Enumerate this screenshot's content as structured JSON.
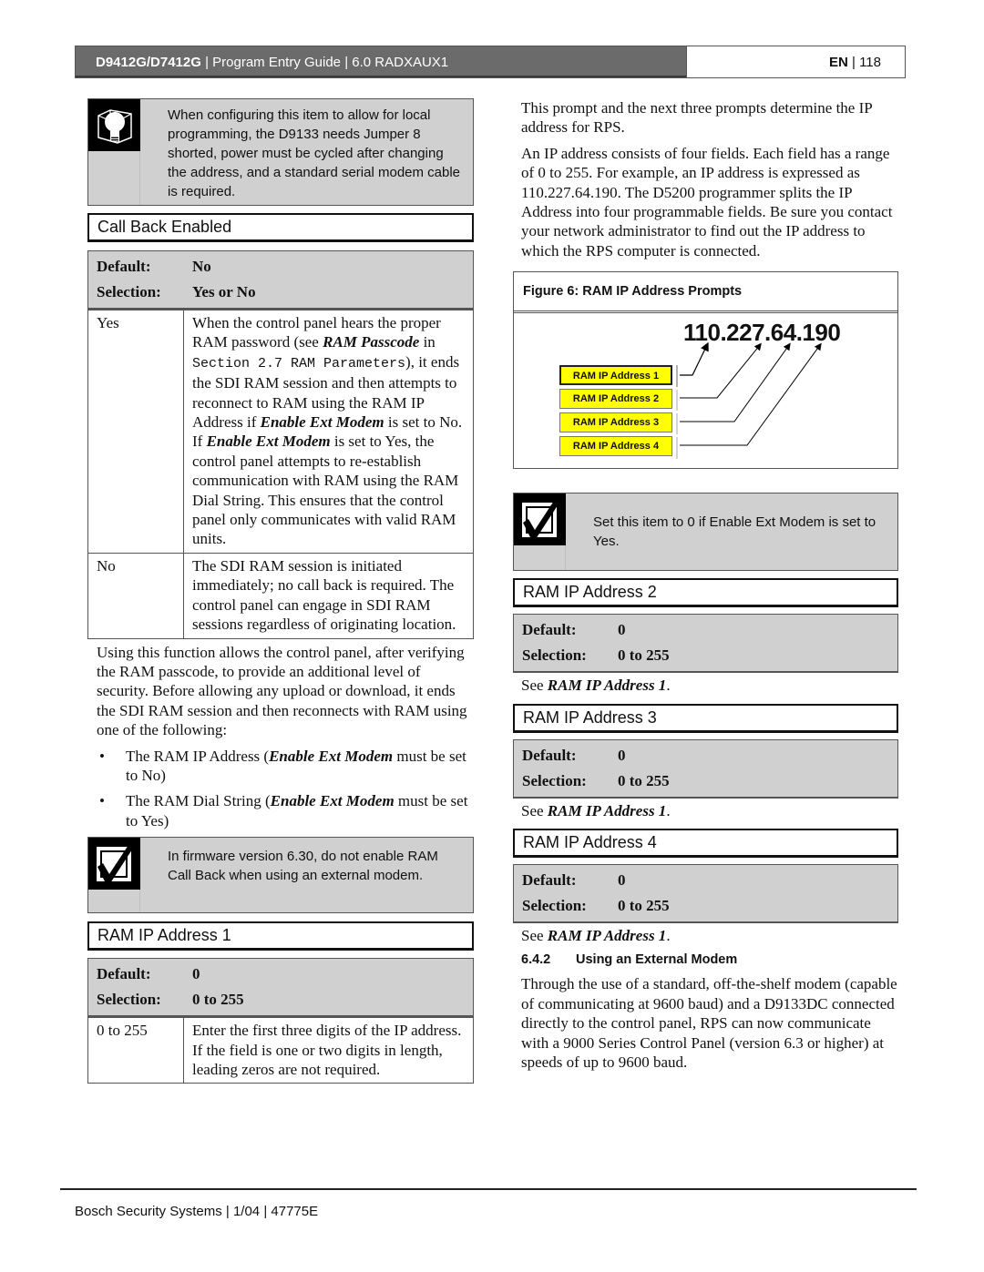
{
  "header": {
    "product": "D9412G/D7412G",
    "guide": "Program Entry Guide",
    "section": "6.0  RADXAUX1",
    "lang": "EN",
    "page": "118"
  },
  "left": {
    "tip_note": {
      "icon": "lightbulb-icon",
      "text": "When configuring this item to allow for local programming, the D9133 needs Jumper 8 shorted, power must be cycled after changing the address, and a standard serial modem cable is required."
    },
    "call_back": {
      "title": "Call Back Enabled",
      "default_label": "Default:",
      "default_value": "No",
      "selection_label": "Selection:",
      "selection_value": "Yes or No",
      "options": [
        {
          "key": "Yes",
          "t1": "When the control panel hears the proper RAM password (see ",
          "t2": "RAM Passcode",
          "t3": " in ",
          "t4": "Section 2.7 RAM Parameters",
          "t5": "), it ends the SDI RAM session and then attempts to reconnect to RAM using the RAM IP Address if ",
          "t6": "Enable Ext Modem",
          "t7": " is set to No. If ",
          "t8": "Enable Ext Modem",
          "t9": " is set to Yes, the control panel attempts to re-establish communication with RAM using the RAM Dial String. This ensures that the control panel only communicates with valid RAM units."
        },
        {
          "key": "No",
          "text": "The SDI RAM session is initiated immediately; no call back is required. The control panel can engage in SDI RAM sessions regardless of originating location."
        }
      ],
      "description": "Using this function allows the control panel, after verifying the RAM passcode, to provide an additional level of security. Before allowing any upload or download, it ends the SDI RAM session and then reconnects with RAM using one of the following:",
      "bullets": [
        {
          "a": "The RAM IP Address (",
          "b": "Enable Ext Modem",
          "c": " must be set to No)"
        },
        {
          "a": "The RAM Dial String (",
          "b": "Enable Ext Modem",
          "c": " must be set to Yes)"
        }
      ]
    },
    "check_note": {
      "icon": "checkbox-checked-icon",
      "text": "In firmware version 6.30, do not enable RAM Call Back when using an external modem."
    },
    "ram_ip_1": {
      "title": "RAM IP Address 1",
      "default_label": "Default:",
      "default_value": "0",
      "selection_label": "Selection:",
      "selection_value": "0 to 255",
      "options": [
        {
          "key": "0 to 255",
          "text": "Enter the first three digits of the IP address. If the field is one or two digits in length, leading zeros are not required."
        }
      ]
    }
  },
  "right": {
    "intro1": "This prompt and the next three prompts determine the IP address for RPS.",
    "intro2": "An IP address consists of four fields. Each field has a range of 0 to 255. For example, an IP address is expressed as 110.227.64.190. The D5200 programmer splits the IP Address into four programmable fields. Be sure you contact your network administrator to find out the IP address to which the RPS computer is connected.",
    "figure": {
      "caption": "Figure 6: RAM IP Address Prompts",
      "ip_example": "110.227.64.190",
      "labels": [
        "RAM IP Address 1",
        "RAM IP Address 2",
        "RAM IP Address 3",
        "RAM IP Address 4"
      ],
      "label_color": "#ffff00"
    },
    "check_note": {
      "icon": "checkbox-checked-icon",
      "text": "Set this item to 0 if Enable Ext Modem is set to Yes."
    },
    "ram_ip_2": {
      "title": "RAM IP Address 2",
      "default_label": "Default:",
      "default_value": "0",
      "selection_label": "Selection:",
      "selection_value": "0 to 255",
      "see_prefix": "See ",
      "see_ref": "RAM IP Address 1",
      "see_suffix": "."
    },
    "ram_ip_3": {
      "title": "RAM IP Address 3",
      "default_label": "Default:",
      "default_value": "0",
      "selection_label": "Selection:",
      "selection_value": "0 to 255",
      "see_prefix": "See ",
      "see_ref": "RAM IP Address 1",
      "see_suffix": "."
    },
    "ram_ip_4": {
      "title": "RAM IP Address 4",
      "default_label": "Default:",
      "default_value": "0",
      "selection_label": "Selection:",
      "selection_value": "0 to 255",
      "see_prefix": "See ",
      "see_ref": "RAM IP Address 1",
      "see_suffix": "."
    },
    "ext_modem": {
      "number": "6.4.2",
      "title": "Using an External Modem",
      "text": "Through the use of a standard, off-the-shelf modem (capable of communicating at 9600 baud) and a D9133DC connected directly to the control panel, RPS can now communicate with a 9000 Series Control Panel (version 6.3 or higher) at speeds of up to 9600 baud."
    }
  },
  "footer": {
    "company": "Bosch Security Systems",
    "date": "1/04",
    "doc_number": "47775E"
  }
}
